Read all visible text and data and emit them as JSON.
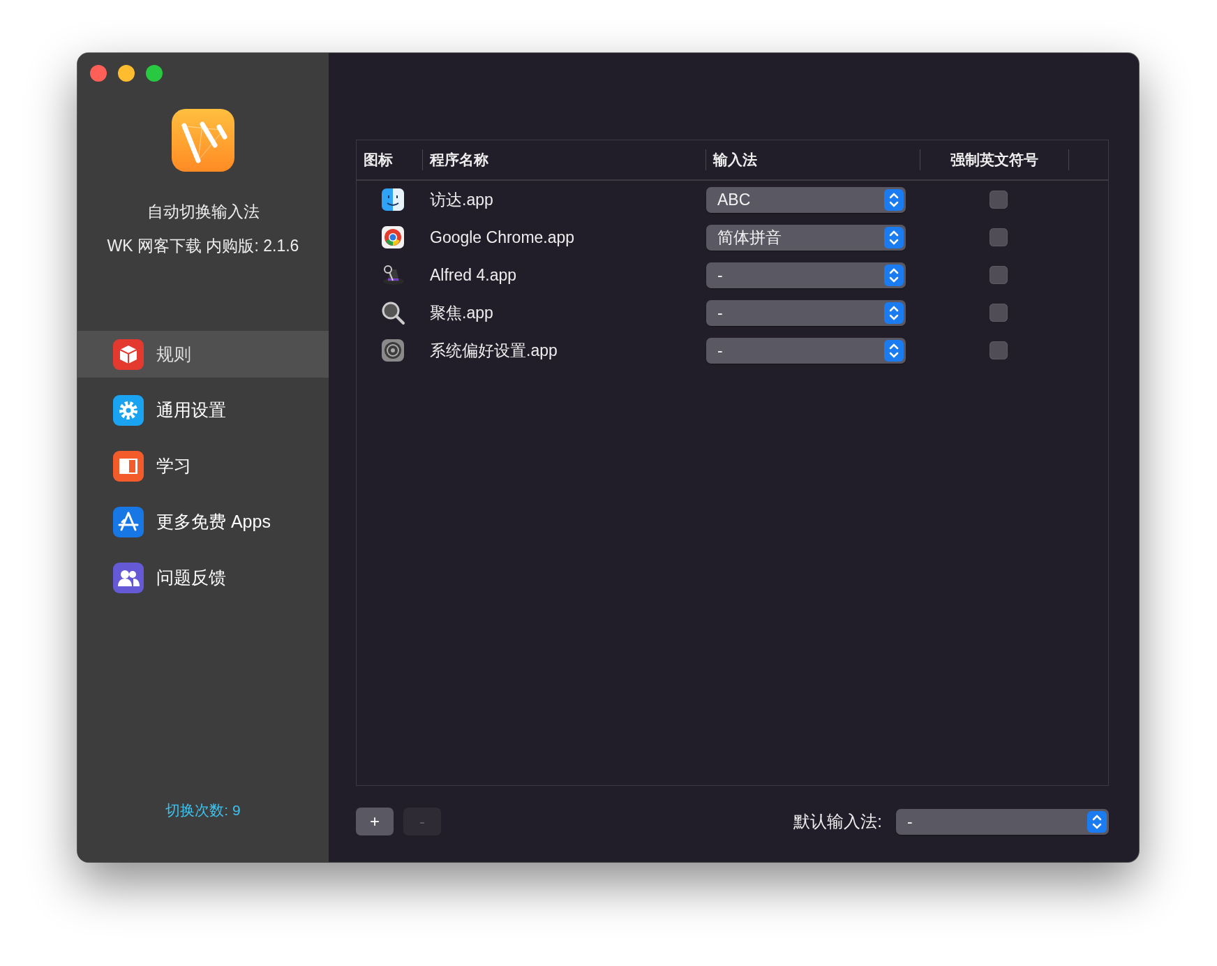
{
  "app": {
    "title": "自动切换输入法",
    "version": "WK 网客下载 内购版: 2.1.6"
  },
  "sidebar": {
    "items": [
      {
        "label": "规则",
        "selected": true
      },
      {
        "label": "通用设置",
        "selected": false
      },
      {
        "label": "学习",
        "selected": false
      },
      {
        "label": "更多免费 Apps",
        "selected": false
      },
      {
        "label": "问题反馈",
        "selected": false
      }
    ],
    "switch_count": "切换次数: 9"
  },
  "table": {
    "columns": [
      "图标",
      "程序名称",
      "输入法",
      "强制英文符号"
    ],
    "rows": [
      {
        "name": "访达.app",
        "input_method": "ABC",
        "force_english": false
      },
      {
        "name": "Google Chrome.app",
        "input_method": "简体拼音",
        "force_english": false
      },
      {
        "name": "Alfred 4.app",
        "input_method": "-",
        "force_english": false
      },
      {
        "name": "聚焦.app",
        "input_method": "-",
        "force_english": false
      },
      {
        "name": "系统偏好设置.app",
        "input_method": "-",
        "force_english": false
      }
    ]
  },
  "buttons": [
    {
      "label": "+",
      "disabled": false
    },
    {
      "label": "-",
      "disabled": true
    }
  ],
  "default_input": {
    "label": "默认输入法:",
    "value": "-"
  }
}
